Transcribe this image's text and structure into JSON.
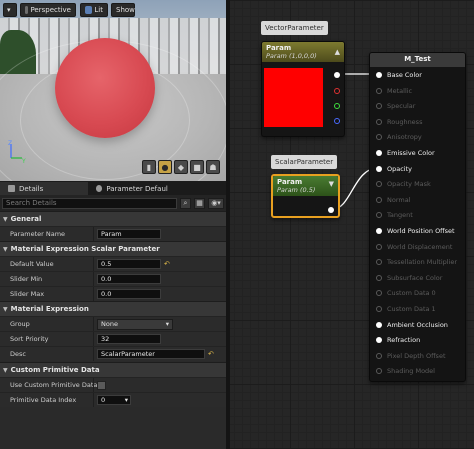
{
  "viewport": {
    "perspective_label": "Perspective",
    "lit_label": "Lit",
    "show_label": "Show",
    "axis": {
      "x": "X",
      "y": "Y",
      "z": "Z"
    }
  },
  "details": {
    "tabs": [
      {
        "label": "Details",
        "icon": "details-icon"
      },
      {
        "label": "Parameter Defaults",
        "icon": "parameter-defaults-icon"
      }
    ],
    "search_placeholder": "Search Details",
    "categories": {
      "general": "General",
      "scalar": "Material Expression Scalar Parameter",
      "expression": "Material Expression",
      "custom": "Custom Primitive Data"
    },
    "props": {
      "parameter_name": {
        "label": "Parameter Name",
        "value": "Param"
      },
      "default_value": {
        "label": "Default Value",
        "value": "0.5"
      },
      "slider_min": {
        "label": "Slider Min",
        "value": "0.0"
      },
      "slider_max": {
        "label": "Slider Max",
        "value": "0.0"
      },
      "group": {
        "label": "Group",
        "value": "None"
      },
      "sort_priority": {
        "label": "Sort Priority",
        "value": "32"
      },
      "desc": {
        "label": "Desc",
        "value": "ScalarParameter"
      },
      "use_custom": {
        "label": "Use Custom Primitive Data",
        "checked": false
      },
      "primitive_index": {
        "label": "Primitive Data Index",
        "value": "0"
      }
    }
  },
  "graph": {
    "vector_comment": "VectorParameter",
    "scalar_comment": "ScalarParameter",
    "vector_node": {
      "title": "Param",
      "subtitle": "Param (1,0,0,0)",
      "swatch_color": "#ff0000"
    },
    "scalar_node": {
      "title": "Param",
      "subtitle": "Param (0.5)"
    },
    "material_node": {
      "title": "M_Test",
      "pins": [
        {
          "label": "Base Color",
          "active": true
        },
        {
          "label": "Metallic",
          "active": false
        },
        {
          "label": "Specular",
          "active": false
        },
        {
          "label": "Roughness",
          "active": false
        },
        {
          "label": "Anisotropy",
          "active": false
        },
        {
          "label": "Emissive Color",
          "active": true
        },
        {
          "label": "Opacity",
          "active": true
        },
        {
          "label": "Opacity Mask",
          "active": false
        },
        {
          "label": "Normal",
          "active": false
        },
        {
          "label": "Tangent",
          "active": false
        },
        {
          "label": "World Position Offset",
          "active": true
        },
        {
          "label": "World Displacement",
          "active": false
        },
        {
          "label": "Tessellation Multiplier",
          "active": false
        },
        {
          "label": "Subsurface Color",
          "active": false
        },
        {
          "label": "Custom Data 0",
          "active": false
        },
        {
          "label": "Custom Data 1",
          "active": false
        },
        {
          "label": "Ambient Occlusion",
          "active": true
        },
        {
          "label": "Refraction",
          "active": true
        },
        {
          "label": "Pixel Depth Offset",
          "active": false
        },
        {
          "label": "Shading Model",
          "active": false
        }
      ]
    },
    "colors": {
      "vector_header": "#6b6a2a",
      "scalar_header": "#3d6a2a",
      "selection": "#e8a020",
      "wire": "#ffffff"
    }
  }
}
